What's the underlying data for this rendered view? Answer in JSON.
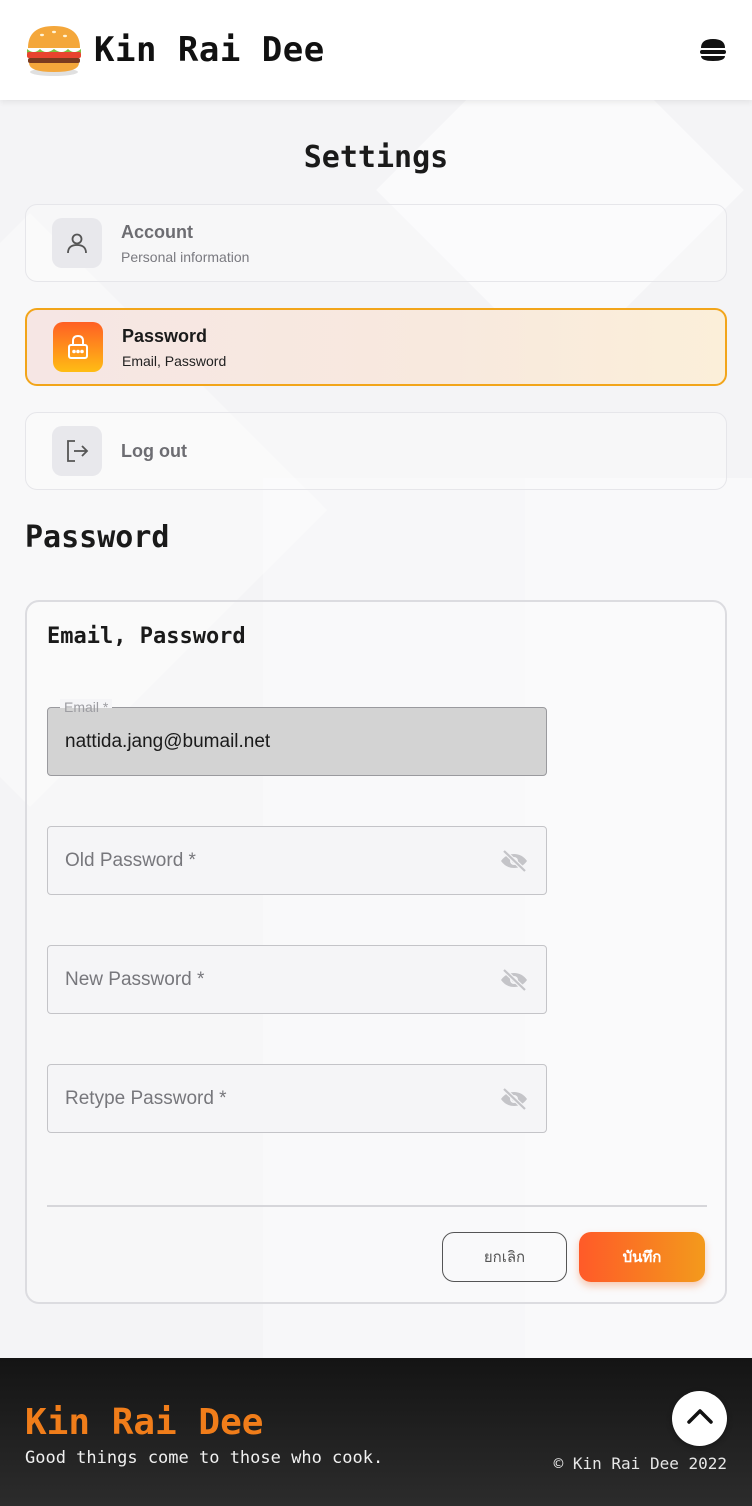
{
  "header": {
    "app_title": "Kin Rai Dee",
    "logo_icon": "burger-logo-icon",
    "menu_icon": "burger-menu-icon"
  },
  "settings": {
    "title": "Settings",
    "menu": [
      {
        "label": "Account",
        "sub": "Personal information",
        "icon": "user-icon"
      },
      {
        "label": "Password",
        "sub": "Email, Password",
        "icon": "lock-icon",
        "active": true
      },
      {
        "label": "Log out",
        "sub": "",
        "icon": "logout-icon"
      }
    ]
  },
  "password_section": {
    "title": "Password",
    "card_title": "Email, Password",
    "email": {
      "label": "Email *",
      "value": "nattida.jang@bumail.net"
    },
    "old_password": {
      "placeholder": "Old Password *",
      "icon": "eye-off-icon"
    },
    "new_password": {
      "placeholder": "New Password *",
      "icon": "eye-off-icon"
    },
    "retype_password": {
      "placeholder": "Retype Password *",
      "icon": "eye-off-icon"
    },
    "cancel_label": "ยกเลิก",
    "save_label": "บันทึก"
  },
  "footer": {
    "brand": "Kin Rai Dee",
    "tagline": "Good things come to those who cook.",
    "copyright": "© Kin Rai Dee 2022",
    "to_top_icon": "chevron-up-icon"
  },
  "colors": {
    "accent_orange": "#f07d1a",
    "active_border": "#f2a51a",
    "save_gradient_start": "#ff5a28",
    "save_gradient_end": "#f39a1c"
  }
}
